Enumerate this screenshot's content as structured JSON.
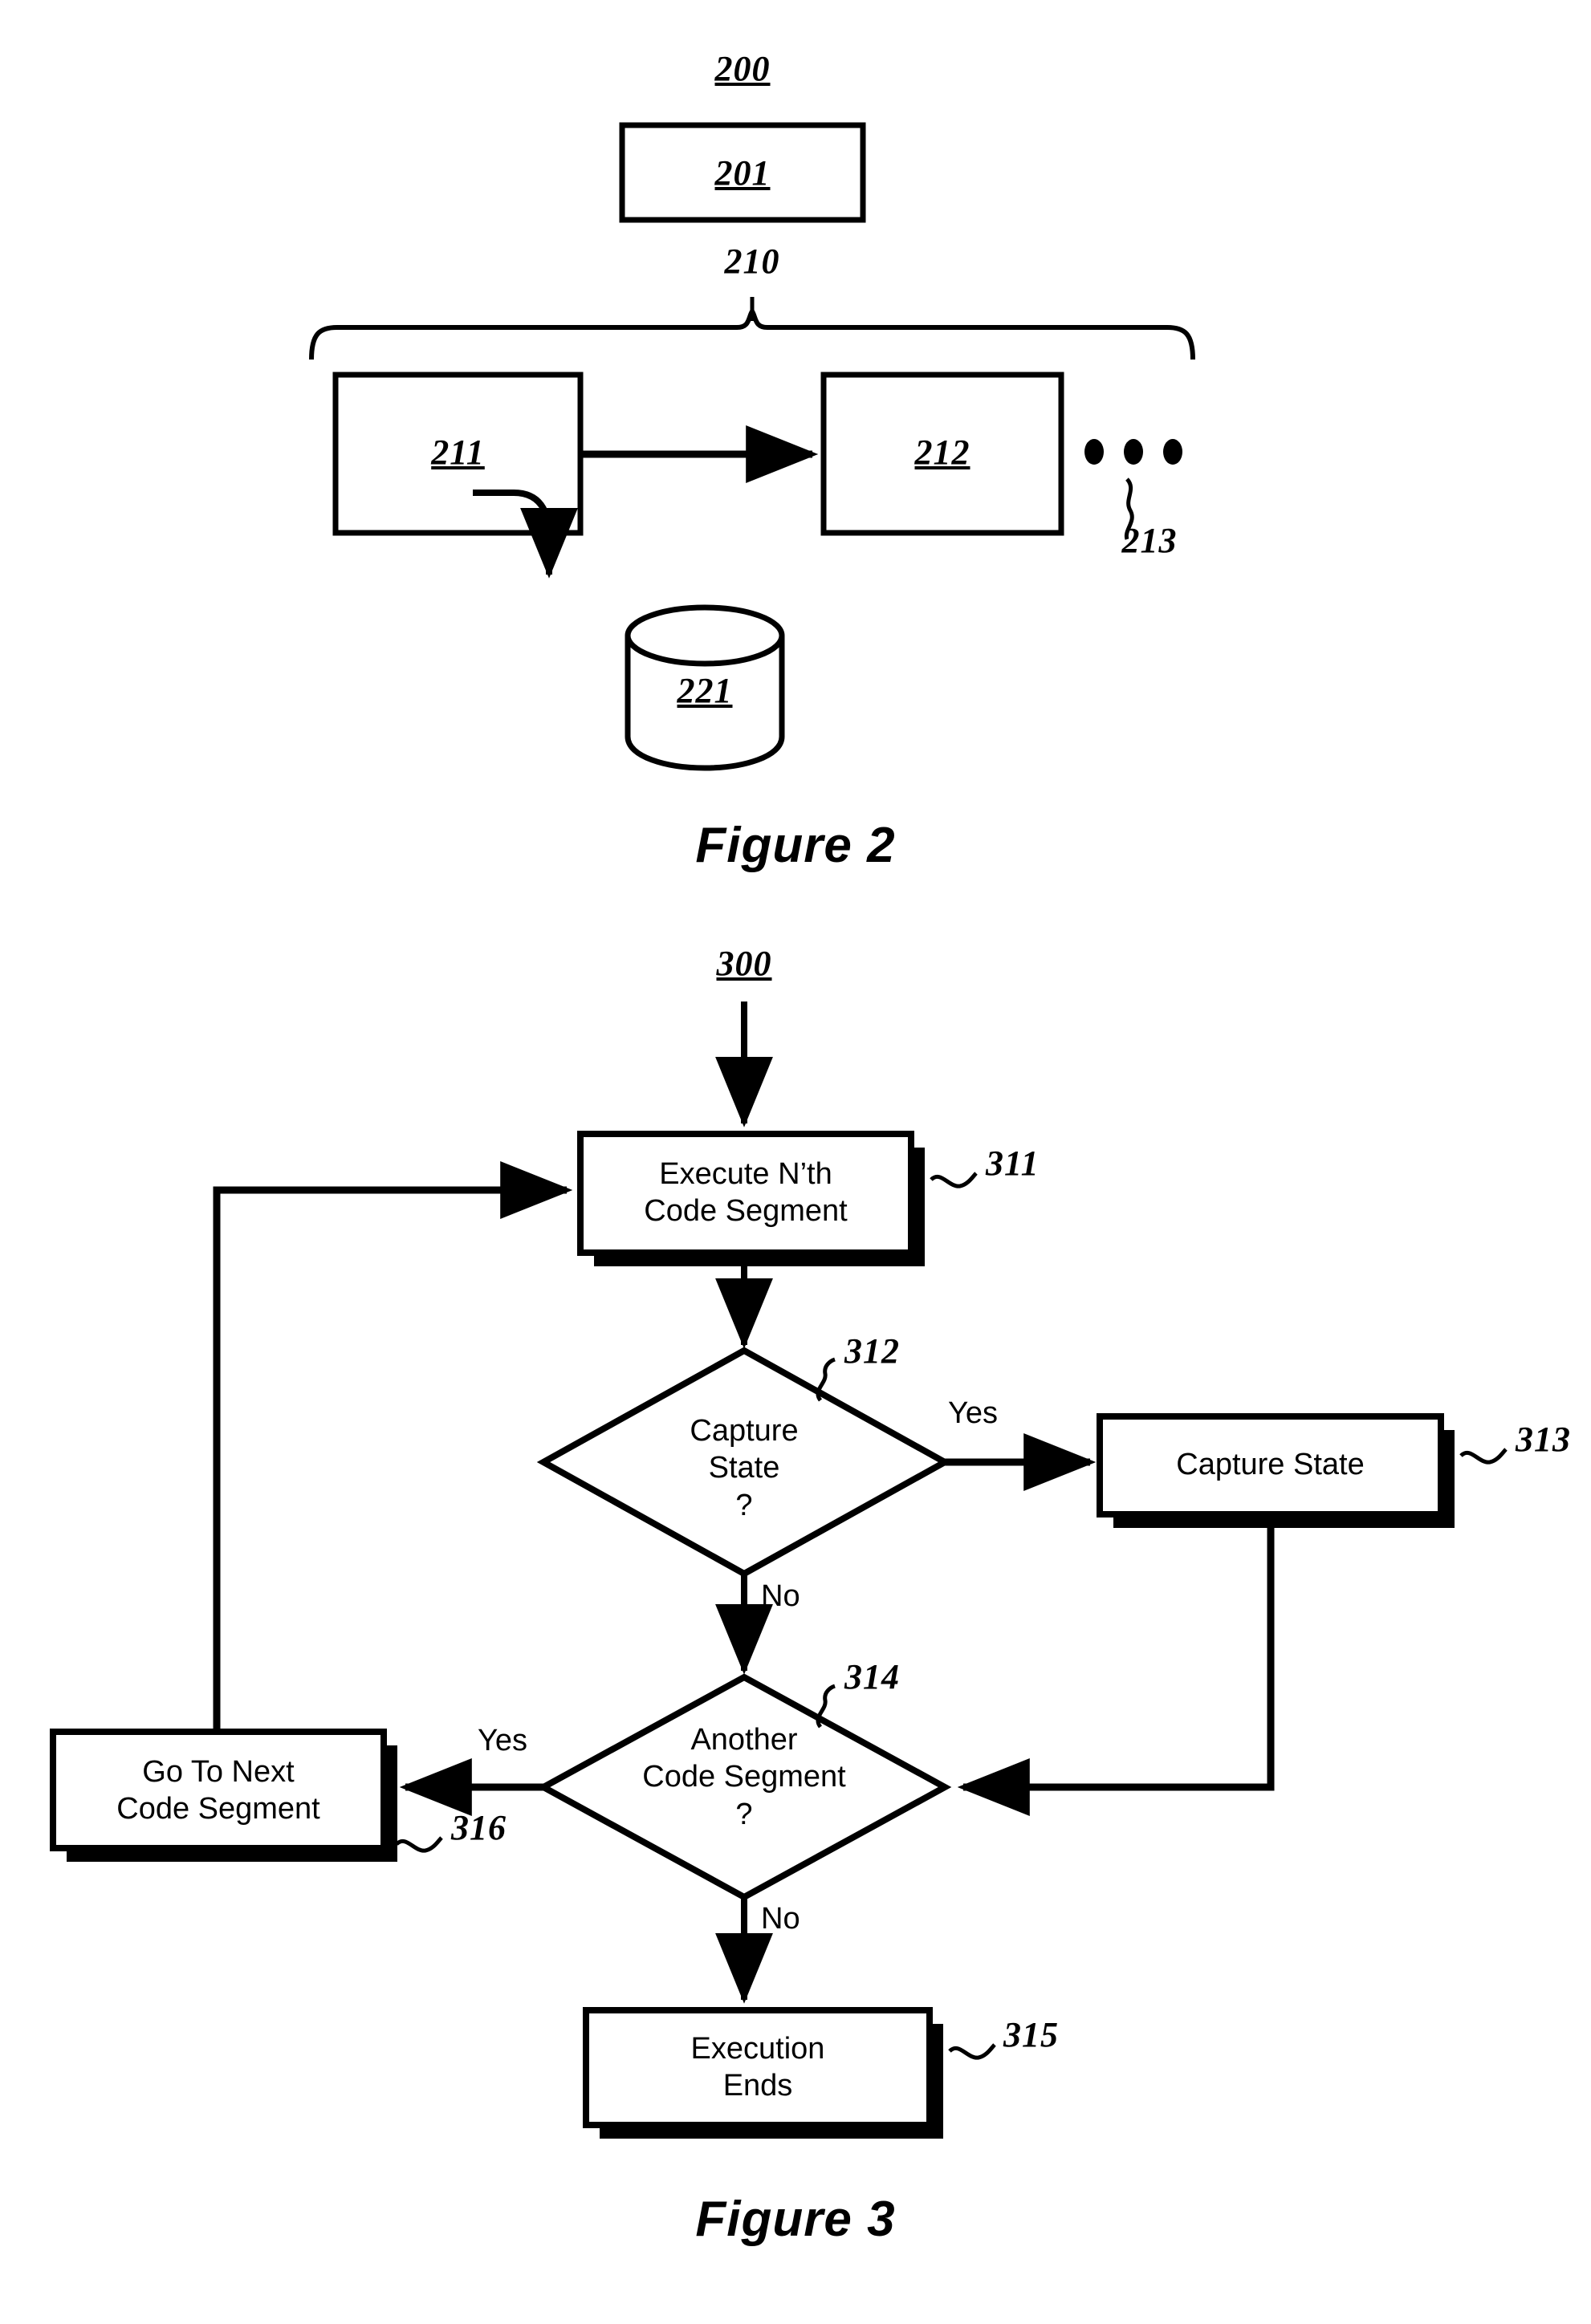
{
  "document": {
    "type": "patent-drawing-sheet",
    "background_color": "#ffffff",
    "line_color": "#000000"
  },
  "figure2": {
    "caption": "Figure 2",
    "system_ref": "200",
    "top_box": {
      "ref": "201"
    },
    "brace_ref": "210",
    "boxes": [
      {
        "ref": "211"
      },
      {
        "ref": "212"
      }
    ],
    "ellipsis": "• • •",
    "ellipsis_ref": "213",
    "datastore": {
      "ref": "221"
    }
  },
  "figure3": {
    "caption": "Figure 3",
    "flow_ref": "300",
    "nodes": [
      {
        "id": "311",
        "ref": "311",
        "shape": "process",
        "label_line1": "Execute N’th",
        "label_line2": "Code Segment"
      },
      {
        "id": "312",
        "ref": "312",
        "shape": "decision",
        "label_line1": "Capture",
        "label_line2": "State",
        "label_line3": "?"
      },
      {
        "id": "313",
        "ref": "313",
        "shape": "process",
        "label_line1": "Capture State",
        "label_line2": ""
      },
      {
        "id": "314",
        "ref": "314",
        "shape": "decision",
        "label_line1": "Another",
        "label_line2": "Code Segment",
        "label_line3": "?"
      },
      {
        "id": "315",
        "ref": "315",
        "shape": "process",
        "label_line1": "Execution",
        "label_line2": "Ends"
      },
      {
        "id": "316",
        "ref": "316",
        "shape": "process",
        "label_line1": "Go To Next",
        "label_line2": "Code Segment"
      }
    ],
    "edge_labels": {
      "yes_312_to_313": "Yes",
      "no_312_to_314": "No",
      "yes_314_to_316": "Yes",
      "no_314_to_315": "No"
    }
  }
}
